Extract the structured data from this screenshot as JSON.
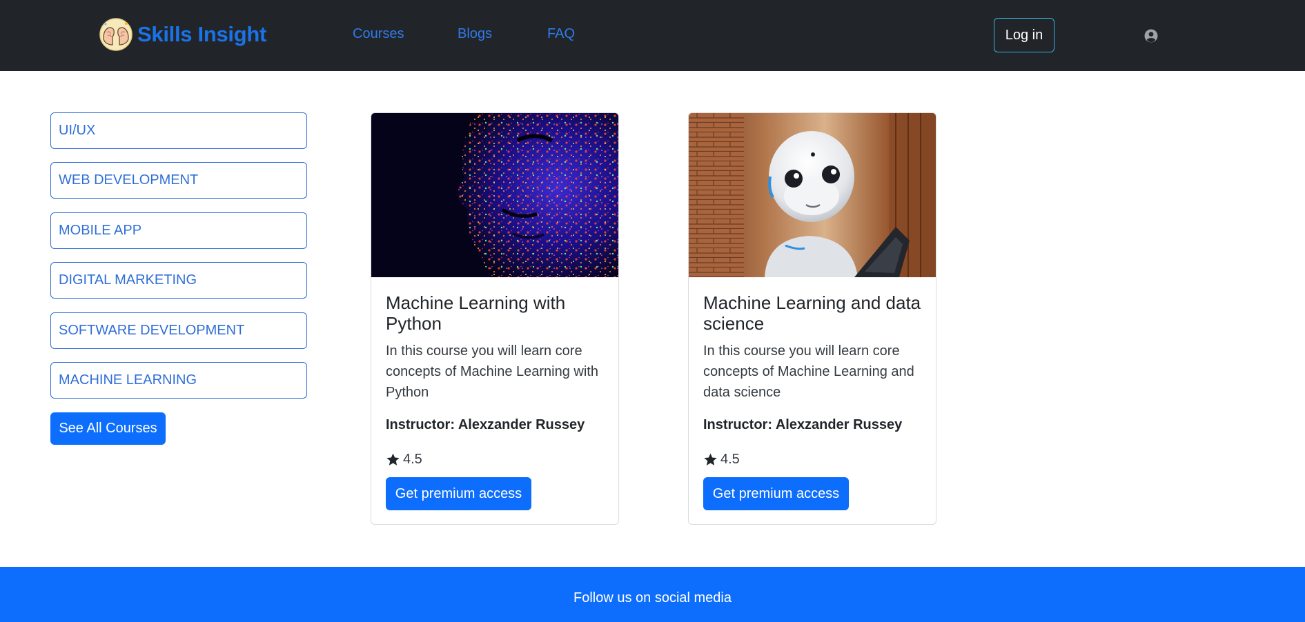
{
  "header": {
    "brand_name": "Skills Insight",
    "logo_icon": "two-brains-logo",
    "nav": [
      {
        "label": "Courses"
      },
      {
        "label": "Blogs"
      },
      {
        "label": "FAQ"
      }
    ],
    "login_label": "Log in",
    "user_icon": "user-circle-icon"
  },
  "sidebar": {
    "categories": [
      {
        "label": "UI/UX"
      },
      {
        "label": "WEB DEVELOPMENT"
      },
      {
        "label": "MOBILE APP"
      },
      {
        "label": "DIGITAL MARKETING"
      },
      {
        "label": "SOFTWARE DEVELOPMENT"
      },
      {
        "label": "MACHINE LEARNING"
      }
    ],
    "see_all_label": "See All Courses"
  },
  "courses": [
    {
      "title": "Machine Learning with Python",
      "description": "In this course you will learn core concepts of Machine Learning with Python",
      "instructor": "Instructor: Alexzander Russey",
      "rating": "4.5",
      "button_label": "Get premium access",
      "image": "glowing-particle-face"
    },
    {
      "title": "Machine Learning and data science",
      "description": "In this course you will learn core concepts of Machine Learning and data science",
      "instructor": "Instructor: Alexzander Russey",
      "rating": "4.5",
      "button_label": "Get premium access",
      "image": "white-humanoid-robot"
    }
  ],
  "footer": {
    "text": "Follow us on social media"
  },
  "colors": {
    "navbar_bg": "#212529",
    "brand_blue": "#1a73e8",
    "primary": "#0d6efd",
    "outline_blue": "#2f6ed8",
    "login_border": "#38b2e0"
  }
}
